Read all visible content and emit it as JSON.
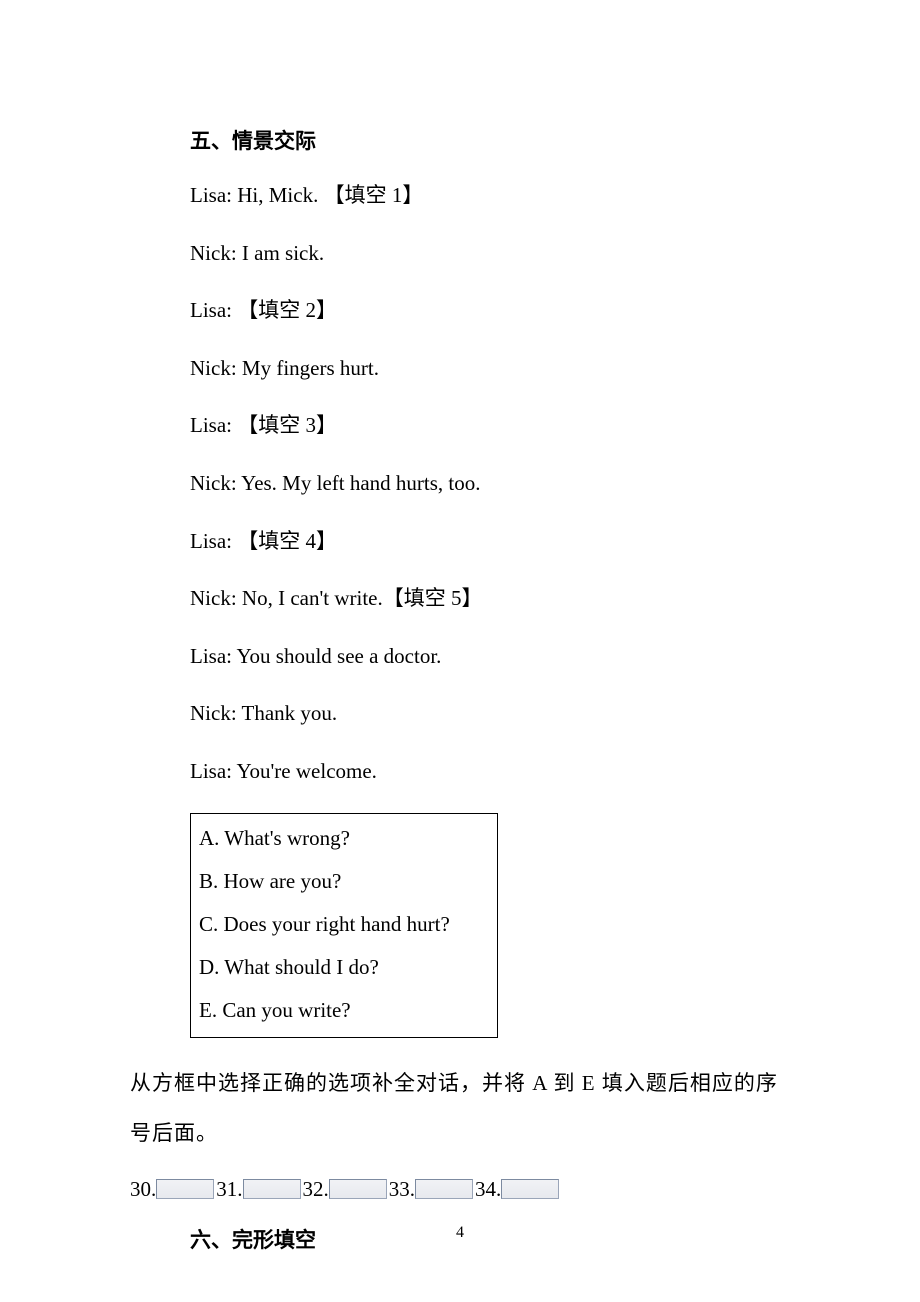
{
  "section5": {
    "heading": "五、情景交际",
    "dialogue": [
      "Lisa: Hi, Mick. 【填空 1】",
      "Nick: I am sick.",
      "Lisa: 【填空 2】",
      "Nick: My fingers hurt.",
      "Lisa: 【填空 3】",
      "Nick: Yes. My left hand hurts, too.",
      "Lisa: 【填空 4】",
      "Nick: No, I can't write.【填空 5】",
      "Lisa: You should see a doctor.",
      "Nick: Thank you.",
      "Lisa: You're welcome."
    ],
    "choices": [
      "A. What's wrong?",
      "B. How are you?",
      "C. Does your right hand hurt?",
      "D. What should I do?",
      "E. Can you write?"
    ],
    "instruction": "从方框中选择正确的选项补全对话，并将 A 到 E 填入题后相应的序号后面。",
    "answers": [
      "30.",
      "31.",
      "32.",
      "33.",
      "34."
    ]
  },
  "section6": {
    "heading": "六、完形填空"
  },
  "pageNumber": "4"
}
